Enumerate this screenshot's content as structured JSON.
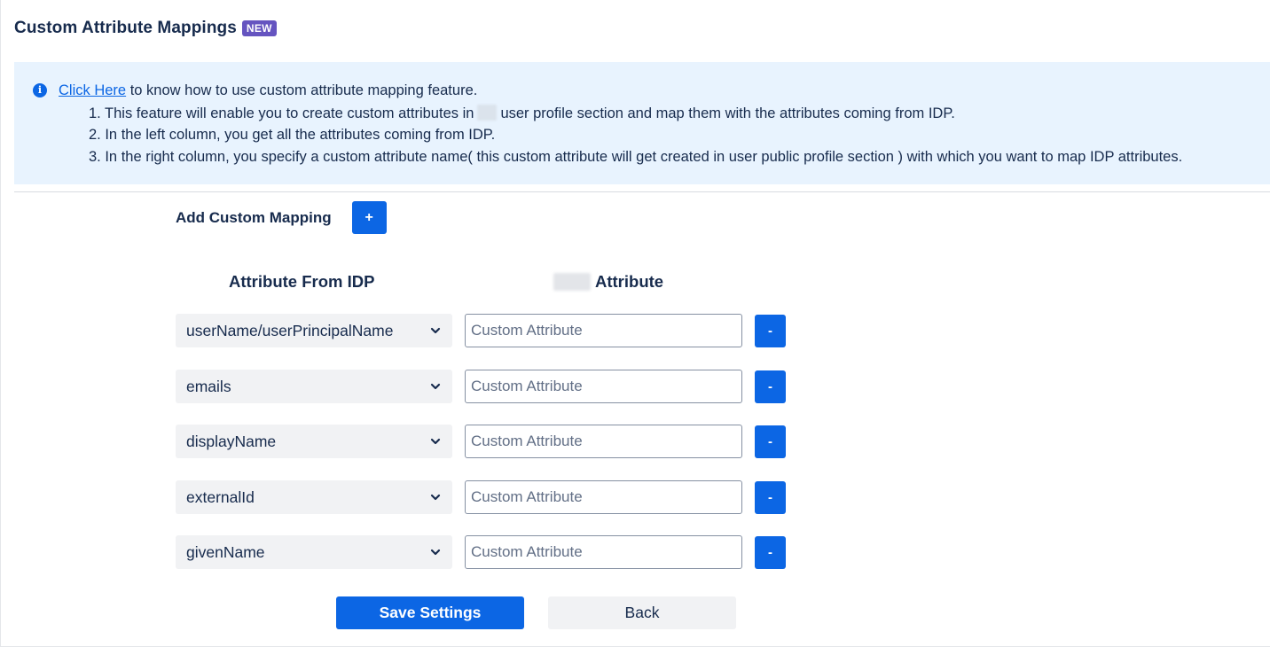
{
  "header": {
    "title": "Custom Attribute Mappings",
    "badge": "NEW"
  },
  "info": {
    "icon": "info-icon",
    "link_text": "Click Here",
    "line0_rest": " to know how to use custom attribute mapping feature.",
    "line1_before": "1. This feature will enable you to create custom attributes in",
    "line1_after": "user profile section and map them with the attributes coming from IDP.",
    "line2": "2. In the left column, you get all the attributes coming from IDP.",
    "line3": "3. In the right column, you specify a custom attribute name( this custom attribute will get created in user public profile section ) with which you want to map IDP attributes."
  },
  "add_mapping": {
    "label": "Add Custom Mapping",
    "button": "+"
  },
  "columns": {
    "left": "Attribute From IDP",
    "right": "Attribute"
  },
  "mappings": [
    {
      "idp_attribute": "userName/userPrincipalName",
      "placeholder": "Custom Attribute",
      "remove": "-"
    },
    {
      "idp_attribute": "emails",
      "placeholder": "Custom Attribute",
      "remove": "-"
    },
    {
      "idp_attribute": "displayName",
      "placeholder": "Custom Attribute",
      "remove": "-"
    },
    {
      "idp_attribute": "externalId",
      "placeholder": "Custom Attribute",
      "remove": "-"
    },
    {
      "idp_attribute": "givenName",
      "placeholder": "Custom Attribute",
      "remove": "-"
    }
  ],
  "actions": {
    "save": "Save Settings",
    "back": "Back"
  },
  "colors": {
    "primary": "#0c66e4",
    "badge": "#6554c0",
    "info_bg": "#e8f3fe",
    "text": "#172b4d"
  }
}
